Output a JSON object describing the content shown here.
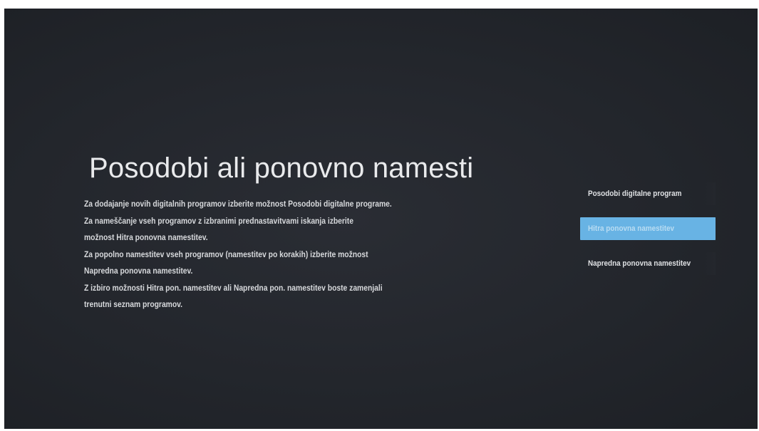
{
  "page": {
    "title": "Posodobi ali ponovno namesti",
    "description_lines": [
      "Za dodajanje novih digitalnih programov izberite možnost Posodobi digitalne programe.",
      "Za nameščanje vseh programov z izbranimi prednastavitvami iskanja izberite",
      "možnost Hitra ponovna namestitev.",
      "Za popolno namestitev vseh programov (namestitev po korakih) izberite možnost",
      "Napredna ponovna namestitev.",
      "Z izbiro možnosti Hitra pon. namestitev ali Napredna pon. namestitev boste zamenjali",
      "trenutni seznam programov."
    ]
  },
  "menu": {
    "items": [
      {
        "label": "Posodobi digitalne program",
        "selected": false
      },
      {
        "label": "Hitra ponovna namestitev",
        "selected": true
      },
      {
        "label": "Napredna ponovna namestitev",
        "selected": false
      }
    ]
  },
  "colors": {
    "background": "#23262c",
    "text": "#e9eaec",
    "accent": "#68b3e4"
  }
}
